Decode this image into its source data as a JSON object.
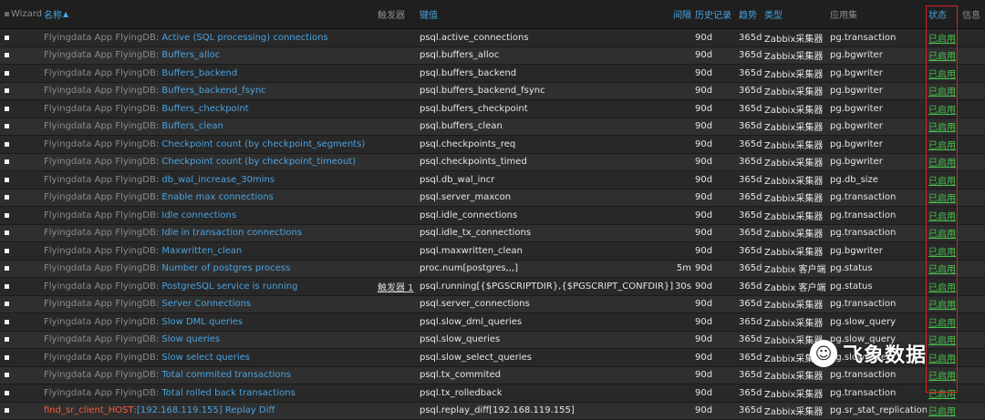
{
  "header": {
    "wizard": "Wizard",
    "name": "名称",
    "sort_mark": "▲",
    "trigger": "触发器",
    "key": "键值",
    "interval": "间隔",
    "history": "历史记录",
    "trend": "趋势",
    "type": "类型",
    "app": "应用集",
    "status": "状态",
    "info": "信息"
  },
  "rows": [
    {
      "prefix": "Flyingdata App FlyingDB",
      "name": "Active (SQL processing) connections",
      "trigger": "",
      "key": "psql.active_connections",
      "interval": "",
      "history": "90d",
      "trend": "365d",
      "type": "Zabbix采集器",
      "app": "pg.transaction",
      "status": "已启用"
    },
    {
      "prefix": "Flyingdata App FlyingDB",
      "name": "Buffers_alloc",
      "trigger": "",
      "key": "psql.buffers_alloc",
      "interval": "",
      "history": "90d",
      "trend": "365d",
      "type": "Zabbix采集器",
      "app": "pg.bgwriter",
      "status": "已启用"
    },
    {
      "prefix": "Flyingdata App FlyingDB",
      "name": "Buffers_backend",
      "trigger": "",
      "key": "psql.buffers_backend",
      "interval": "",
      "history": "90d",
      "trend": "365d",
      "type": "Zabbix采集器",
      "app": "pg.bgwriter",
      "status": "已启用"
    },
    {
      "prefix": "Flyingdata App FlyingDB",
      "name": "Buffers_backend_fsync",
      "trigger": "",
      "key": "psql.buffers_backend_fsync",
      "interval": "",
      "history": "90d",
      "trend": "365d",
      "type": "Zabbix采集器",
      "app": "pg.bgwriter",
      "status": "已启用"
    },
    {
      "prefix": "Flyingdata App FlyingDB",
      "name": "Buffers_checkpoint",
      "trigger": "",
      "key": "psql.buffers_checkpoint",
      "interval": "",
      "history": "90d",
      "trend": "365d",
      "type": "Zabbix采集器",
      "app": "pg.bgwriter",
      "status": "已启用"
    },
    {
      "prefix": "Flyingdata App FlyingDB",
      "name": "Buffers_clean",
      "trigger": "",
      "key": "psql.buffers_clean",
      "interval": "",
      "history": "90d",
      "trend": "365d",
      "type": "Zabbix采集器",
      "app": "pg.bgwriter",
      "status": "已启用"
    },
    {
      "prefix": "Flyingdata App FlyingDB",
      "name": "Checkpoint count (by checkpoint_segments)",
      "trigger": "",
      "key": "psql.checkpoints_req",
      "interval": "",
      "history": "90d",
      "trend": "365d",
      "type": "Zabbix采集器",
      "app": "pg.bgwriter",
      "status": "已启用"
    },
    {
      "prefix": "Flyingdata App FlyingDB",
      "name": "Checkpoint count (by checkpoint_timeout)",
      "trigger": "",
      "key": "psql.checkpoints_timed",
      "interval": "",
      "history": "90d",
      "trend": "365d",
      "type": "Zabbix采集器",
      "app": "pg.bgwriter",
      "status": "已启用"
    },
    {
      "prefix": "Flyingdata App FlyingDB",
      "name": "db_wal_increase_30mins",
      "trigger": "",
      "key": "psql.db_wal_incr",
      "interval": "",
      "history": "90d",
      "trend": "365d",
      "type": "Zabbix采集器",
      "app": "pg.db_size",
      "status": "已启用"
    },
    {
      "prefix": "Flyingdata App FlyingDB",
      "name": "Enable max connections",
      "trigger": "",
      "key": "psql.server_maxcon",
      "interval": "",
      "history": "90d",
      "trend": "365d",
      "type": "Zabbix采集器",
      "app": "pg.transaction",
      "status": "已启用"
    },
    {
      "prefix": "Flyingdata App FlyingDB",
      "name": "Idle connections",
      "trigger": "",
      "key": "psql.idle_connections",
      "interval": "",
      "history": "90d",
      "trend": "365d",
      "type": "Zabbix采集器",
      "app": "pg.transaction",
      "status": "已启用"
    },
    {
      "prefix": "Flyingdata App FlyingDB",
      "name": "Idle in transaction connections",
      "trigger": "",
      "key": "psql.idle_tx_connections",
      "interval": "",
      "history": "90d",
      "trend": "365d",
      "type": "Zabbix采集器",
      "app": "pg.transaction",
      "status": "已启用"
    },
    {
      "prefix": "Flyingdata App FlyingDB",
      "name": "Maxwritten_clean",
      "trigger": "",
      "key": "psql.maxwritten_clean",
      "interval": "",
      "history": "90d",
      "trend": "365d",
      "type": "Zabbix采集器",
      "app": "pg.bgwriter",
      "status": "已启用"
    },
    {
      "prefix": "Flyingdata App FlyingDB",
      "name": "Number of postgres process",
      "trigger": "",
      "key": "proc.num[postgres,,,]",
      "interval": "5m",
      "history": "90d",
      "trend": "365d",
      "type": "Zabbix 客户端",
      "app": "pg.status",
      "status": "已启用"
    },
    {
      "prefix": "Flyingdata App FlyingDB",
      "name": "PostgreSQL service is running",
      "trigger": "触发器 1",
      "key": "psql.running[{$PGSCRIPTDIR},{$PGSCRIPT_CONFDIR}]",
      "interval": "30s",
      "history": "90d",
      "trend": "365d",
      "type": "Zabbix 客户端",
      "app": "pg.status",
      "status": "已启用"
    },
    {
      "prefix": "Flyingdata App FlyingDB",
      "name": "Server Connections",
      "trigger": "",
      "key": "psql.server_connections",
      "interval": "",
      "history": "90d",
      "trend": "365d",
      "type": "Zabbix采集器",
      "app": "pg.transaction",
      "status": "已启用"
    },
    {
      "prefix": "Flyingdata App FlyingDB",
      "name": "Slow DML queries",
      "trigger": "",
      "key": "psql.slow_dml_queries",
      "interval": "",
      "history": "90d",
      "trend": "365d",
      "type": "Zabbix采集器",
      "app": "pg.slow_query",
      "status": "已启用"
    },
    {
      "prefix": "Flyingdata App FlyingDB",
      "name": "Slow queries",
      "trigger": "",
      "key": "psql.slow_queries",
      "interval": "",
      "history": "90d",
      "trend": "365d",
      "type": "Zabbix采集器",
      "app": "pg.slow_query",
      "status": "已启用"
    },
    {
      "prefix": "Flyingdata App FlyingDB",
      "name": "Slow select queries",
      "trigger": "",
      "key": "psql.slow_select_queries",
      "interval": "",
      "history": "90d",
      "trend": "365d",
      "type": "Zabbix采集器",
      "app": "pg.slow_query",
      "status": "已启用"
    },
    {
      "prefix": "Flyingdata App FlyingDB",
      "name": "Total commited transactions",
      "trigger": "",
      "key": "psql.tx_commited",
      "interval": "",
      "history": "90d",
      "trend": "365d",
      "type": "Zabbix采集器",
      "app": "pg.transaction",
      "status": "已启用"
    },
    {
      "prefix": "Flyingdata App FlyingDB",
      "name": "Total rolled back transactions",
      "trigger": "",
      "key": "psql.tx_rolledback",
      "interval": "",
      "history": "90d",
      "trend": "365d",
      "type": "Zabbix采集器",
      "app": "pg.transaction",
      "status": "已启用"
    },
    {
      "prefix": "find_sr_client_HOST",
      "ip": "[192.168.119.155]",
      "name": "Replay Diff",
      "trigger": "",
      "key": "psql.replay_diff[192.168.119.155]",
      "interval": "",
      "history": "90d",
      "trend": "365d",
      "type": "Zabbix采集器",
      "app": "pg.sr_stat_replication",
      "status": "已启用",
      "highlight": true
    }
  ],
  "watermark": {
    "text": "飞象数据",
    "icon": "wechat-icon"
  },
  "colors": {
    "link": "#4aa3df",
    "enabled": "#47c24b",
    "highlight_box": "#e01f1f",
    "red_prefix": "#ff5a36"
  }
}
